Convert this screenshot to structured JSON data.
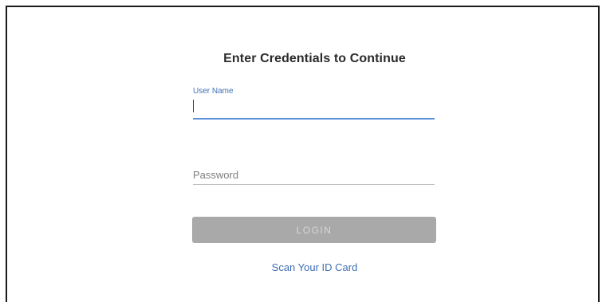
{
  "login": {
    "title": "Enter Credentials to Continue",
    "username": {
      "label": "User Name",
      "value": ""
    },
    "password": {
      "placeholder": "Password",
      "value": ""
    },
    "login_button_label": "LOGIN",
    "scan_id_link": "Scan Your ID Card"
  },
  "colors": {
    "accent": "#3f6fb5",
    "button_disabled_bg": "#a9a9a9",
    "button_disabled_text": "#d7d7d7"
  }
}
